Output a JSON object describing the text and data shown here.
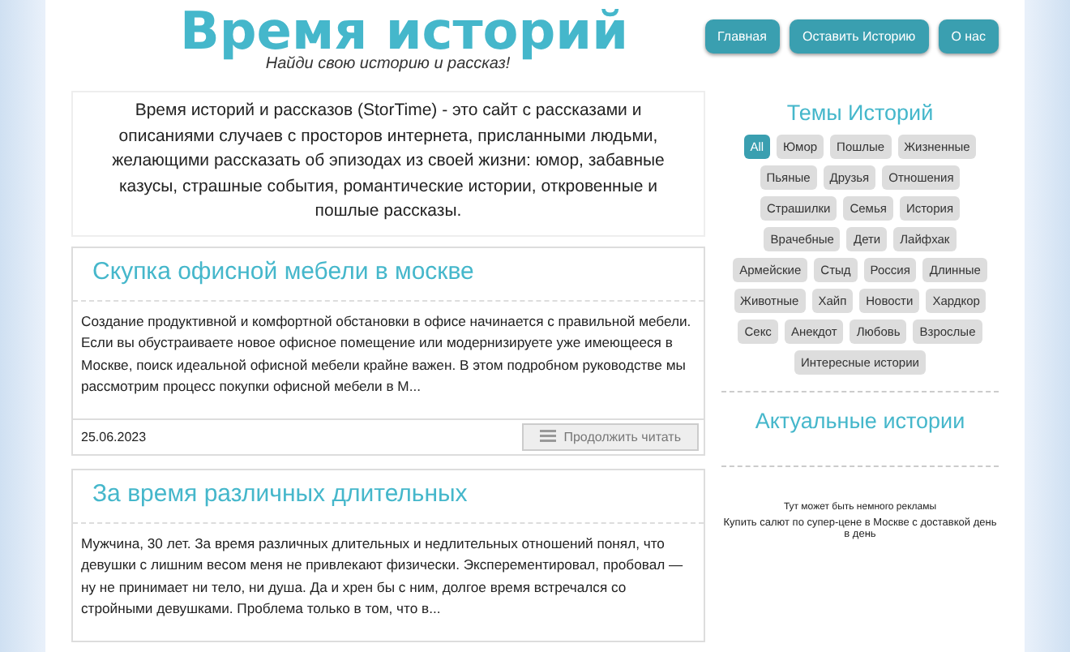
{
  "header": {
    "title": "Время историй",
    "tagline": "Найди свою историю и рассказ!"
  },
  "nav": [
    {
      "label": "Главная"
    },
    {
      "label": "Оставить Историю"
    },
    {
      "label": "О нас"
    }
  ],
  "intro": "Время историй и рассказов (StorTime) - это сайт с рассказами и описаниями случаев с просторов интернета, присланными людьми, желающими рассказать об эпизодах из своей жизни: юмор, забавные казусы, страшные события, романтические истории, откровенные и пошлые рассказы.",
  "posts": [
    {
      "title": "Скупка офисной мебели в москве",
      "excerpt": "Создание продуктивной и комфортной обстановки в офисе начинается с правильной мебели. Если вы обустраиваете новое офисное помещение или модернизируете уже имеющееся в Москве, поиск идеальной офисной мебели крайне важен. В этом подробном руководстве мы рассмотрим процесс покупки офисной мебели в М...",
      "date": "25.06.2023",
      "button": "Продолжить читать"
    },
    {
      "title": "За время различных длительных",
      "excerpt": "Мужчина, 30 лет. За время различных длительных и недлительных отношений понял, что девушки с лишним весом меня не привлекают физически. Эксперементировал, пробовал — ну не принимает ни тело, ни душа. Да и хрен бы с ним, долгое время встречался со стройными девушками. Проблема только в том, что в..."
    }
  ],
  "sidebar": {
    "topics_title": "Темы Историй",
    "tags": [
      {
        "label": "All",
        "selected": true
      },
      {
        "label": "Юмор",
        "selected": false
      },
      {
        "label": "Пошлые",
        "selected": false
      },
      {
        "label": "Жизненные",
        "selected": false
      },
      {
        "label": "Пьяные",
        "selected": false
      },
      {
        "label": "Друзья",
        "selected": false
      },
      {
        "label": "Отношения",
        "selected": false
      },
      {
        "label": "Страшилки",
        "selected": false
      },
      {
        "label": "Семья",
        "selected": false
      },
      {
        "label": "История",
        "selected": false
      },
      {
        "label": "Врачебные",
        "selected": false
      },
      {
        "label": "Дети",
        "selected": false
      },
      {
        "label": "Лайфхак",
        "selected": false
      },
      {
        "label": "Армейские",
        "selected": false
      },
      {
        "label": "Стыд",
        "selected": false
      },
      {
        "label": "Россия",
        "selected": false
      },
      {
        "label": "Длинные",
        "selected": false
      },
      {
        "label": "Животные",
        "selected": false
      },
      {
        "label": "Хайп",
        "selected": false
      },
      {
        "label": "Новости",
        "selected": false
      },
      {
        "label": "Хардкор",
        "selected": false
      },
      {
        "label": "Секс",
        "selected": false
      },
      {
        "label": "Анекдот",
        "selected": false
      },
      {
        "label": "Любовь",
        "selected": false
      },
      {
        "label": "Взрослые",
        "selected": false
      },
      {
        "label": "Интересные истории",
        "selected": false
      }
    ],
    "actual_title": "Актуальные истории",
    "ad_note": "Тут может быть немного рекламы",
    "ad_link": "Купить салют по супер-цене в Москве с доставкой день в день"
  }
}
